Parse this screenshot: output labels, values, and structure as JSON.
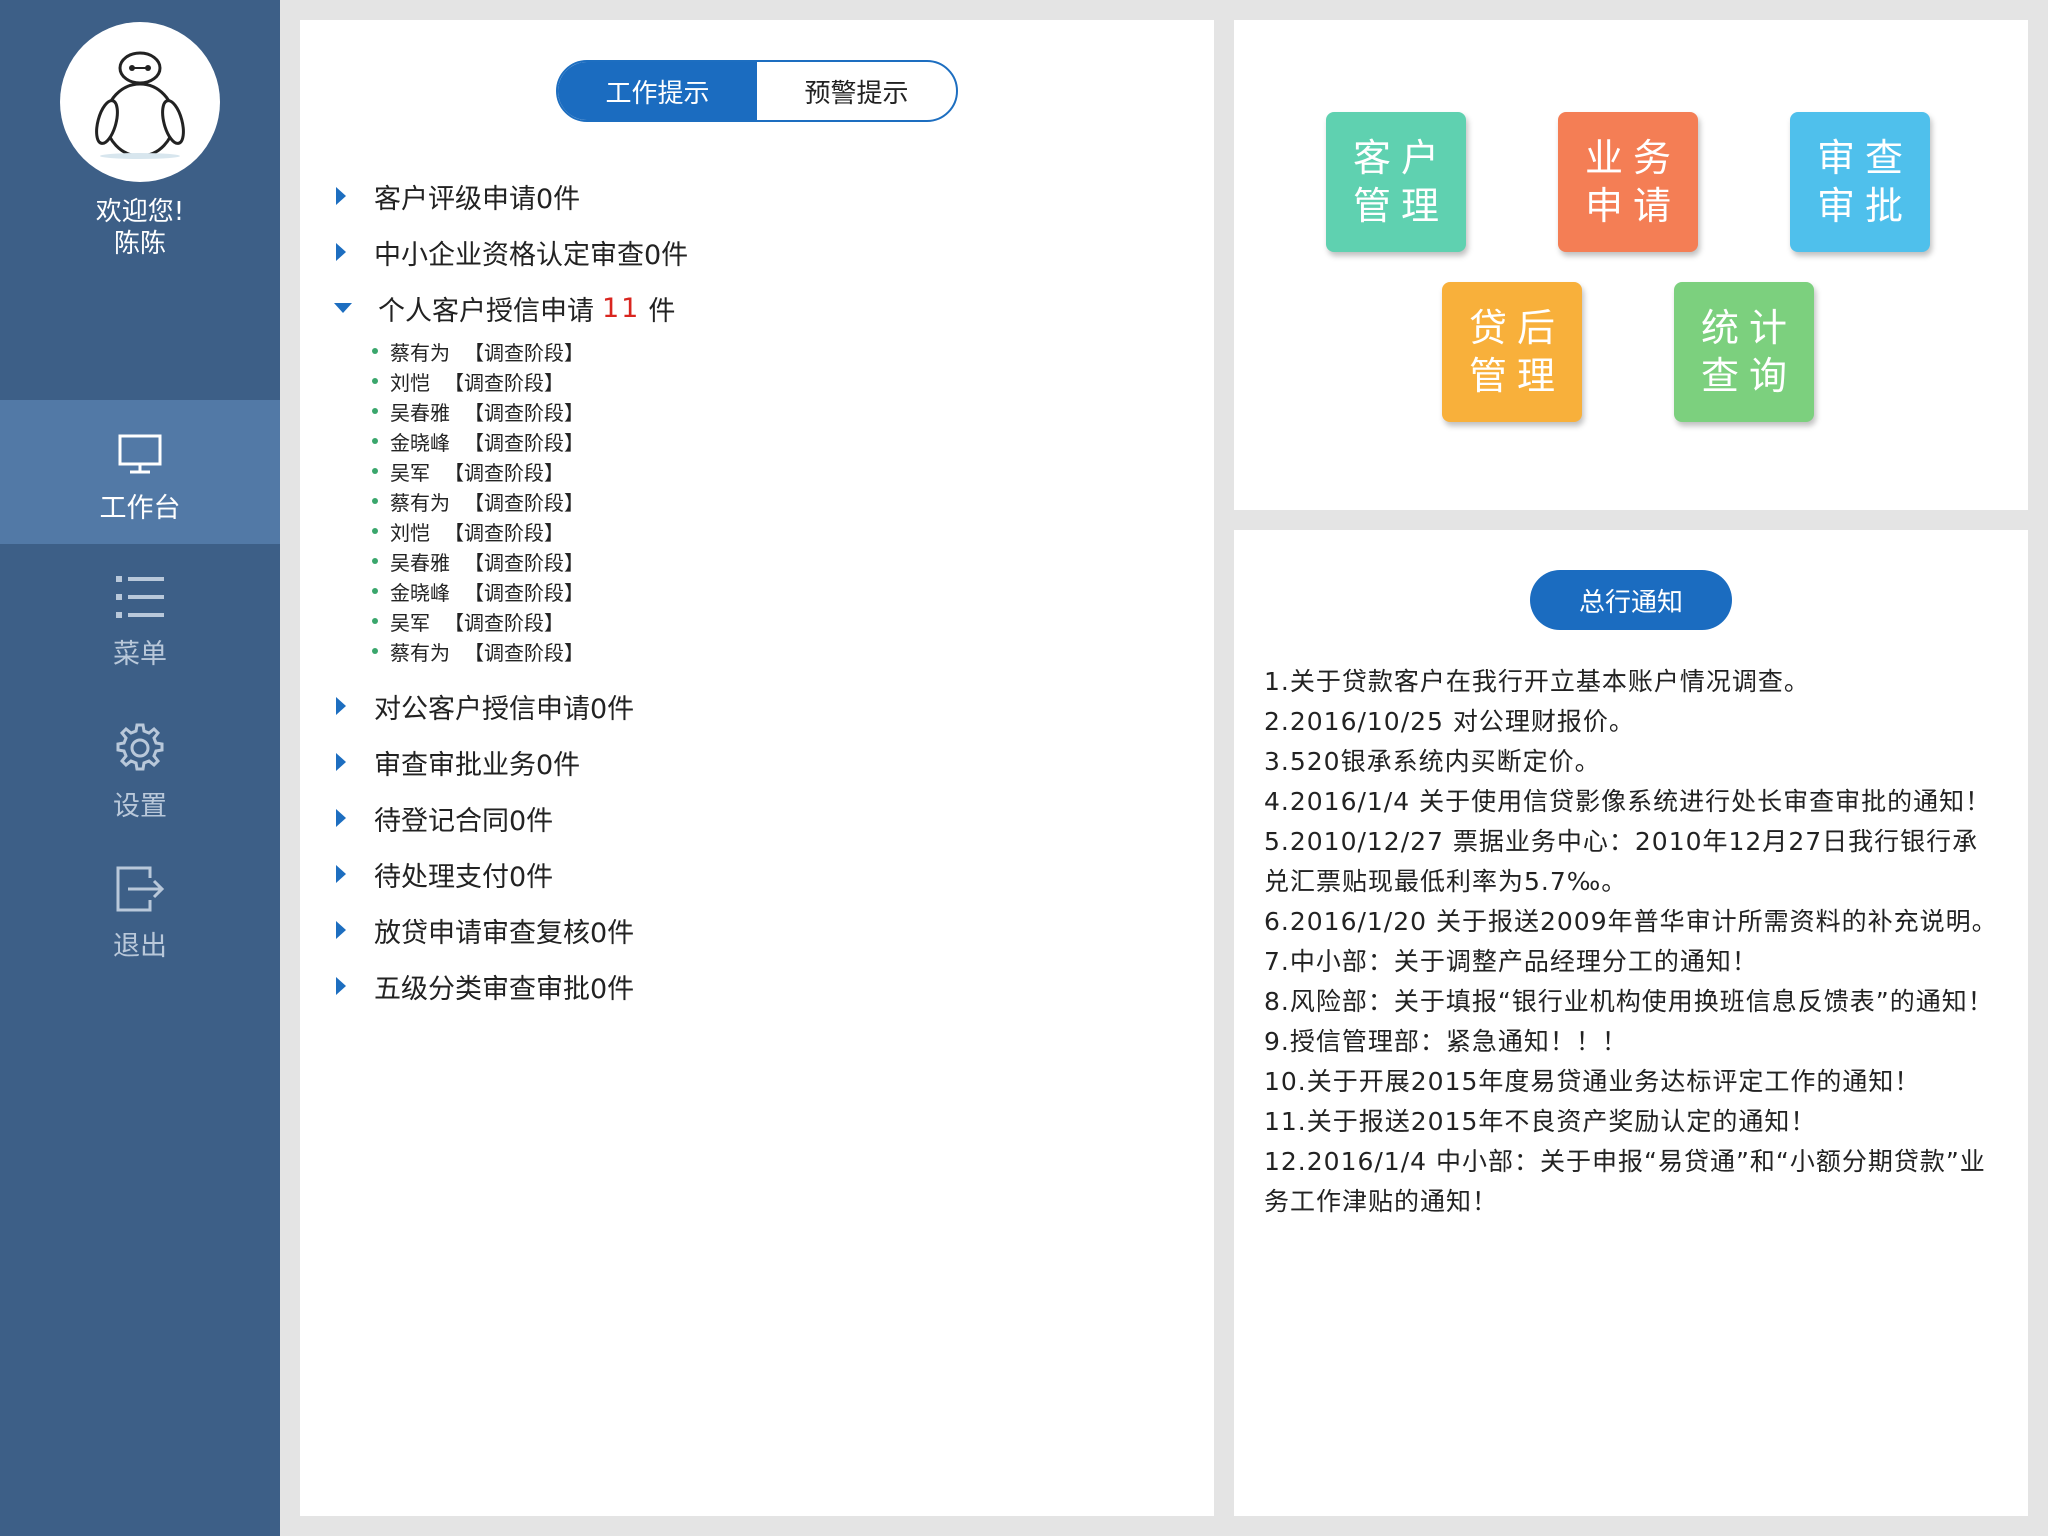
{
  "user": {
    "greeting": "欢迎您!",
    "name": "陈陈"
  },
  "nav": [
    {
      "label": "工作台",
      "icon": "monitor-icon",
      "active": true
    },
    {
      "label": "菜单",
      "icon": "list-icon",
      "active": false
    },
    {
      "label": "设置",
      "icon": "gear-icon",
      "active": false
    },
    {
      "label": "退出",
      "icon": "logout-icon",
      "active": false
    }
  ],
  "tabs": [
    {
      "label": "工作提示",
      "active": true
    },
    {
      "label": "预警提示",
      "active": false
    }
  ],
  "tasks_top": [
    {
      "label": "客户评级申请0件"
    },
    {
      "label": "中小企业资格认定审查0件"
    }
  ],
  "expanded_task": {
    "prefix": "个人客户授信申请",
    "count": "11",
    "suffix": "件"
  },
  "applicants": [
    {
      "name": "蔡有为",
      "stage": "【调查阶段】"
    },
    {
      "name": "刘恺",
      "stage": "【调查阶段】"
    },
    {
      "name": "吴春雅",
      "stage": "【调查阶段】"
    },
    {
      "name": "金晓峰",
      "stage": "【调查阶段】"
    },
    {
      "name": "吴军",
      "stage": "【调查阶段】"
    },
    {
      "name": "蔡有为",
      "stage": "【调查阶段】"
    },
    {
      "name": "刘恺",
      "stage": "【调查阶段】"
    },
    {
      "name": "吴春雅",
      "stage": "【调查阶段】"
    },
    {
      "name": "金晓峰",
      "stage": "【调查阶段】"
    },
    {
      "name": "吴军",
      "stage": "【调查阶段】"
    },
    {
      "name": "蔡有为",
      "stage": "【调查阶段】"
    }
  ],
  "tasks_bottom": [
    {
      "label": "对公客户授信申请0件"
    },
    {
      "label": "审查审批业务0件"
    },
    {
      "label": "待登记合同0件"
    },
    {
      "label": "待处理支付0件"
    },
    {
      "label": "放贷申请审查复核0件"
    },
    {
      "label": "五级分类审查审批0件"
    }
  ],
  "tiles": [
    {
      "line1": "客户",
      "line2": "管理",
      "color": "#5fd1b0"
    },
    {
      "line1": "业务",
      "line2": "申请",
      "color": "#f47e55"
    },
    {
      "line1": "审查",
      "line2": "审批",
      "color": "#4fc0ec"
    },
    {
      "line1": "贷后",
      "line2": "管理",
      "color": "#f8b03b"
    },
    {
      "line1": "统计",
      "line2": "查询",
      "color": "#7cd07e"
    }
  ],
  "notice_title": "总行通知",
  "notices": [
    "1.关于贷款客户在我行开立基本账户情况调查。",
    "2.2016/10/25 对公理财报价。",
    "3.520银承系统内买断定价。",
    "4.2016/1/4 关于使用信贷影像系统进行处长审查审批的通知！",
    "5.2010/12/27 票据业务中心：2010年12月27日我行银行承兑汇票贴现最低利率为5.7‰。",
    "6.2016/1/20 关于报送2009年普华审计所需资料的补充说明。",
    "7.中小部：关于调整产品经理分工的通知！",
    "8.风险部：关于填报“银行业机构使用换班信息反馈表”的通知！",
    "9.授信管理部：紧急通知！！！",
    "10.关于开展2015年度易贷通业务达标评定工作的通知！",
    "11.关于报送2015年不良资产奖励认定的通知！",
    "12.2016/1/4 中小部：关于申报“易贷通”和“小额分期贷款”业务工作津贴的通知！"
  ]
}
